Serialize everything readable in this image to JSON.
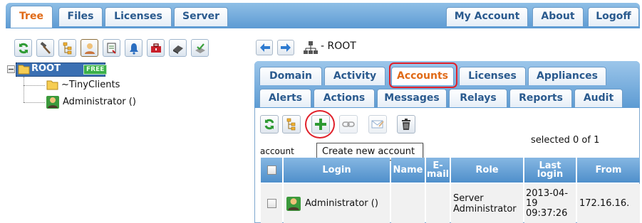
{
  "top_tabs": [
    {
      "label": "Tree",
      "active": true
    },
    {
      "label": "Files",
      "active": false
    },
    {
      "label": "Licenses",
      "active": false
    },
    {
      "label": "Server",
      "active": false
    }
  ],
  "top_right_tabs": [
    {
      "label": "My Account"
    },
    {
      "label": "About"
    },
    {
      "label": "Logoff"
    }
  ],
  "left_toolbar": {
    "icons": [
      "refresh-icon",
      "hammer-icon",
      "tree-view-icon",
      "user-icon",
      "report-icon",
      "bell-icon",
      "toolbox-icon",
      "eraser-icon",
      "check-stamp-icon"
    ]
  },
  "tree": {
    "root": {
      "label": "ROOT",
      "badge": "FREE"
    },
    "children": [
      {
        "label": "~TinyClients",
        "icon": "folder-icon"
      },
      {
        "label": "Administrator ()",
        "icon": "admin-user-icon"
      }
    ]
  },
  "breadcrumb": {
    "label": "- ROOT"
  },
  "right_tabs_row1": [
    {
      "label": "Domain"
    },
    {
      "label": "Activity"
    },
    {
      "label": "Accounts",
      "active": true
    },
    {
      "label": "Licenses"
    },
    {
      "label": "Appliances"
    }
  ],
  "right_tabs_row2": [
    {
      "label": "Alerts"
    },
    {
      "label": "Actions"
    },
    {
      "label": "Messages"
    },
    {
      "label": "Relays"
    },
    {
      "label": "Reports"
    },
    {
      "label": "Audit"
    }
  ],
  "accounts_toolbar": {
    "tooltip": "Create new account",
    "icons": [
      "refresh-icon",
      "tree-view-icon",
      "add-icon",
      "link-icon",
      "message-icon",
      "trash-icon"
    ]
  },
  "selection": {
    "text": "selected 0 of 1"
  },
  "section_label": "account",
  "table": {
    "headers": {
      "login": "Login",
      "name": "Name",
      "email_1": "E-",
      "email_2": "mail",
      "role": "Role",
      "last_1": "Last",
      "last_2": "login",
      "from": "From"
    },
    "rows": [
      {
        "login": "Administrator ()",
        "name": "",
        "email": "",
        "role_1": "Server",
        "role_2": "Administrator",
        "last_1": "2013-04-",
        "last_2": "19",
        "last_3": "09:37:26",
        "from": "172.16.16."
      }
    ]
  },
  "colors": {
    "accent": "#e06a17",
    "tab_bar": "#5d9bd3",
    "highlight": "#e0202a",
    "root_selected": "#3a6fb2"
  }
}
